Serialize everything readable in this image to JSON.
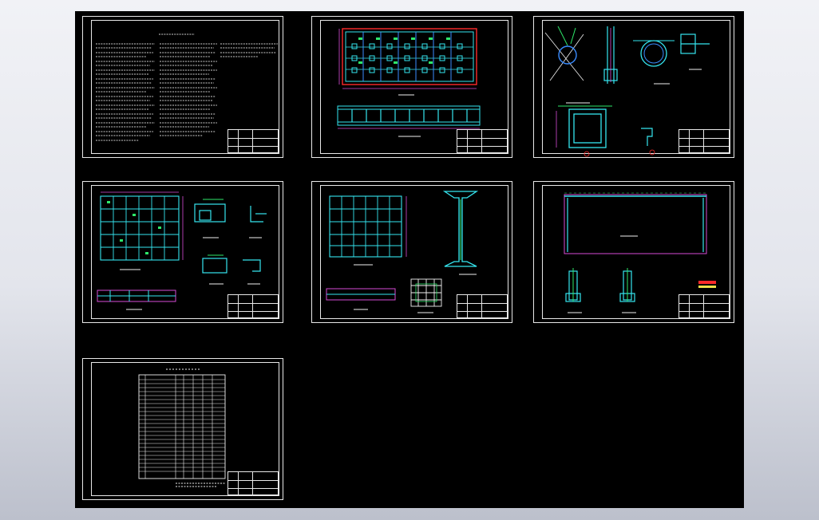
{
  "window": {
    "title": ""
  },
  "colors": {
    "canvas": "#000000",
    "sheet_border": "#e8e8e8",
    "cyan": "#35e6f0",
    "magenta": "#d64bd6",
    "green": "#2ee86a",
    "red": "#ff2a2a",
    "yellow": "#f2e24a",
    "blue": "#3a8cff",
    "white": "#f0f0f0"
  },
  "sheets": [
    {
      "id": "sheet-1",
      "content": "text-notes",
      "title_block": ""
    },
    {
      "id": "sheet-2",
      "content": "plan-and-section",
      "title_block": ""
    },
    {
      "id": "sheet-3",
      "content": "detail-drawings",
      "title_block": ""
    },
    {
      "id": "sheet-4",
      "content": "grid-plan-and-details",
      "title_block": ""
    },
    {
      "id": "sheet-5",
      "content": "grid-plan-and-column",
      "title_block": ""
    },
    {
      "id": "sheet-6",
      "content": "long-elevation",
      "title_block": ""
    },
    {
      "id": "sheet-7",
      "content": "schedule-table",
      "title_block": ""
    }
  ]
}
